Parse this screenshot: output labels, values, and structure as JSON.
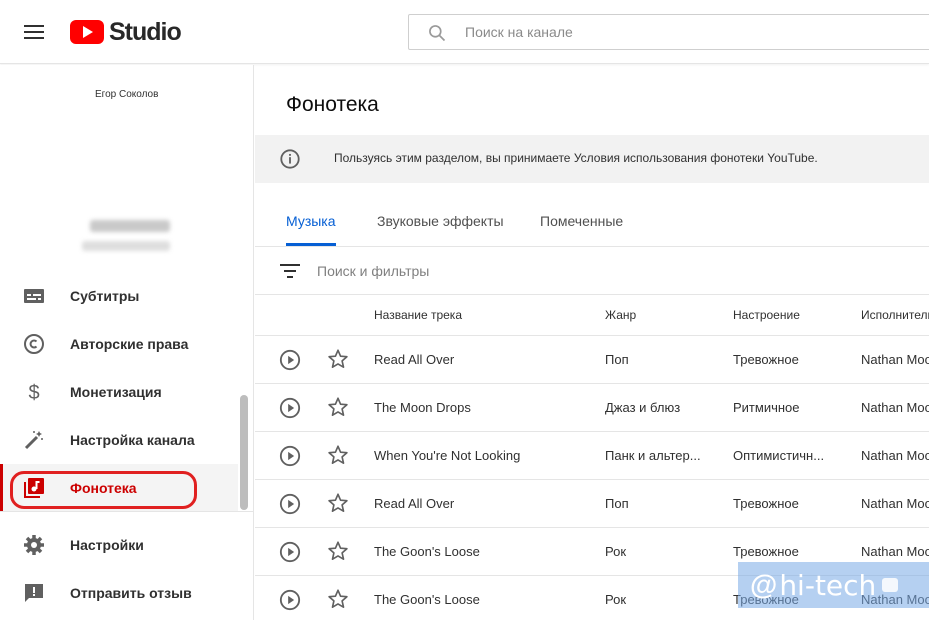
{
  "header": {
    "logo_text": "Studio",
    "search_placeholder": "Поиск на канале"
  },
  "sidebar": {
    "channel_label": "Егор Соколов",
    "items": [
      {
        "label": "Субтитры",
        "icon": "subtitles-icon"
      },
      {
        "label": "Авторские права",
        "icon": "copyright-icon"
      },
      {
        "label": "Монетизация",
        "icon": "dollar-icon"
      },
      {
        "label": "Настройка канала",
        "icon": "magic-wand-icon"
      },
      {
        "label": "Фонотека",
        "icon": "audio-library-icon",
        "active": true
      },
      {
        "label": "Настройки",
        "icon": "gear-icon"
      },
      {
        "label": "Отправить отзыв",
        "icon": "feedback-icon"
      }
    ]
  },
  "main": {
    "title": "Фонотека",
    "banner_text": "Пользуясь этим разделом, вы принимаете Условия использования фонотеки YouTube.",
    "tabs": [
      {
        "label": "Музыка",
        "active": true
      },
      {
        "label": "Звуковые эффекты"
      },
      {
        "label": "Помеченные"
      }
    ],
    "filter_placeholder": "Поиск и фильтры",
    "columns": [
      "Название трека",
      "Жанр",
      "Настроение",
      "Исполнитель"
    ],
    "rows": [
      {
        "title": "Read All Over",
        "genre": "Поп",
        "mood": "Тревожное",
        "artist": "Nathan Moore"
      },
      {
        "title": "The Moon Drops",
        "genre": "Джаз и блюз",
        "mood": "Ритмичное",
        "artist": "Nathan Moore"
      },
      {
        "title": "When You're Not Looking",
        "genre": "Панк и альтер...",
        "mood": "Оптимистичн...",
        "artist": "Nathan Moore"
      },
      {
        "title": "Read All Over",
        "genre": "Поп",
        "mood": "Тревожное",
        "artist": "Nathan Moore"
      },
      {
        "title": "The Goon's Loose",
        "genre": "Рок",
        "mood": "Тревожное",
        "artist": "Nathan Moore"
      },
      {
        "title": "The Goon's Loose",
        "genre": "Рок",
        "mood": "Тревожное",
        "artist": "Nathan Moore"
      }
    ]
  },
  "watermark": {
    "at": "@",
    "text": "hi-tech"
  },
  "colors": {
    "accent": "#065fd4",
    "active_nav": "#cc0000",
    "brand_red": "#ff0000",
    "highlight": "#e02020"
  }
}
